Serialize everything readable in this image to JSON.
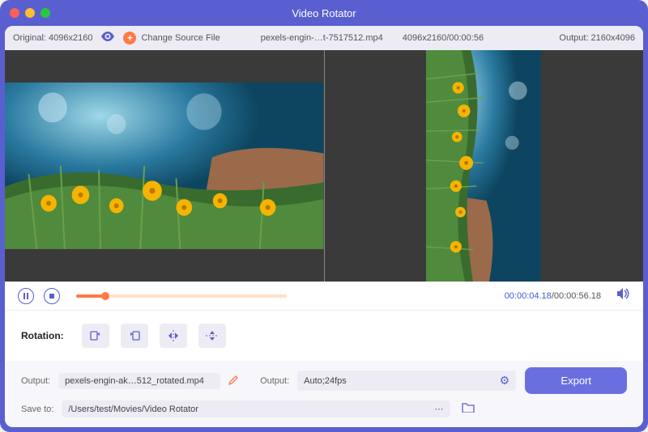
{
  "window": {
    "title": "Video Rotator"
  },
  "info": {
    "original_label": "Original: 4096x2160",
    "change_source": "Change Source File",
    "filename": "pexels-engin-…t-7517512.mp4",
    "meta": "4096x2160/00:00:56",
    "output_label": "Output: 2160x4096"
  },
  "playback": {
    "current": "00:00:04.18",
    "duration": "00:00:56.18"
  },
  "rotation": {
    "label": "Rotation:"
  },
  "output": {
    "out_label": "Output:",
    "filename": "pexels-engin-ak…512_rotated.mp4",
    "format_label": "Output:",
    "format_value": "Auto;24fps",
    "save_label": "Save to:",
    "save_path": "/Users/test/Movies/Video Rotator",
    "export": "Export"
  }
}
